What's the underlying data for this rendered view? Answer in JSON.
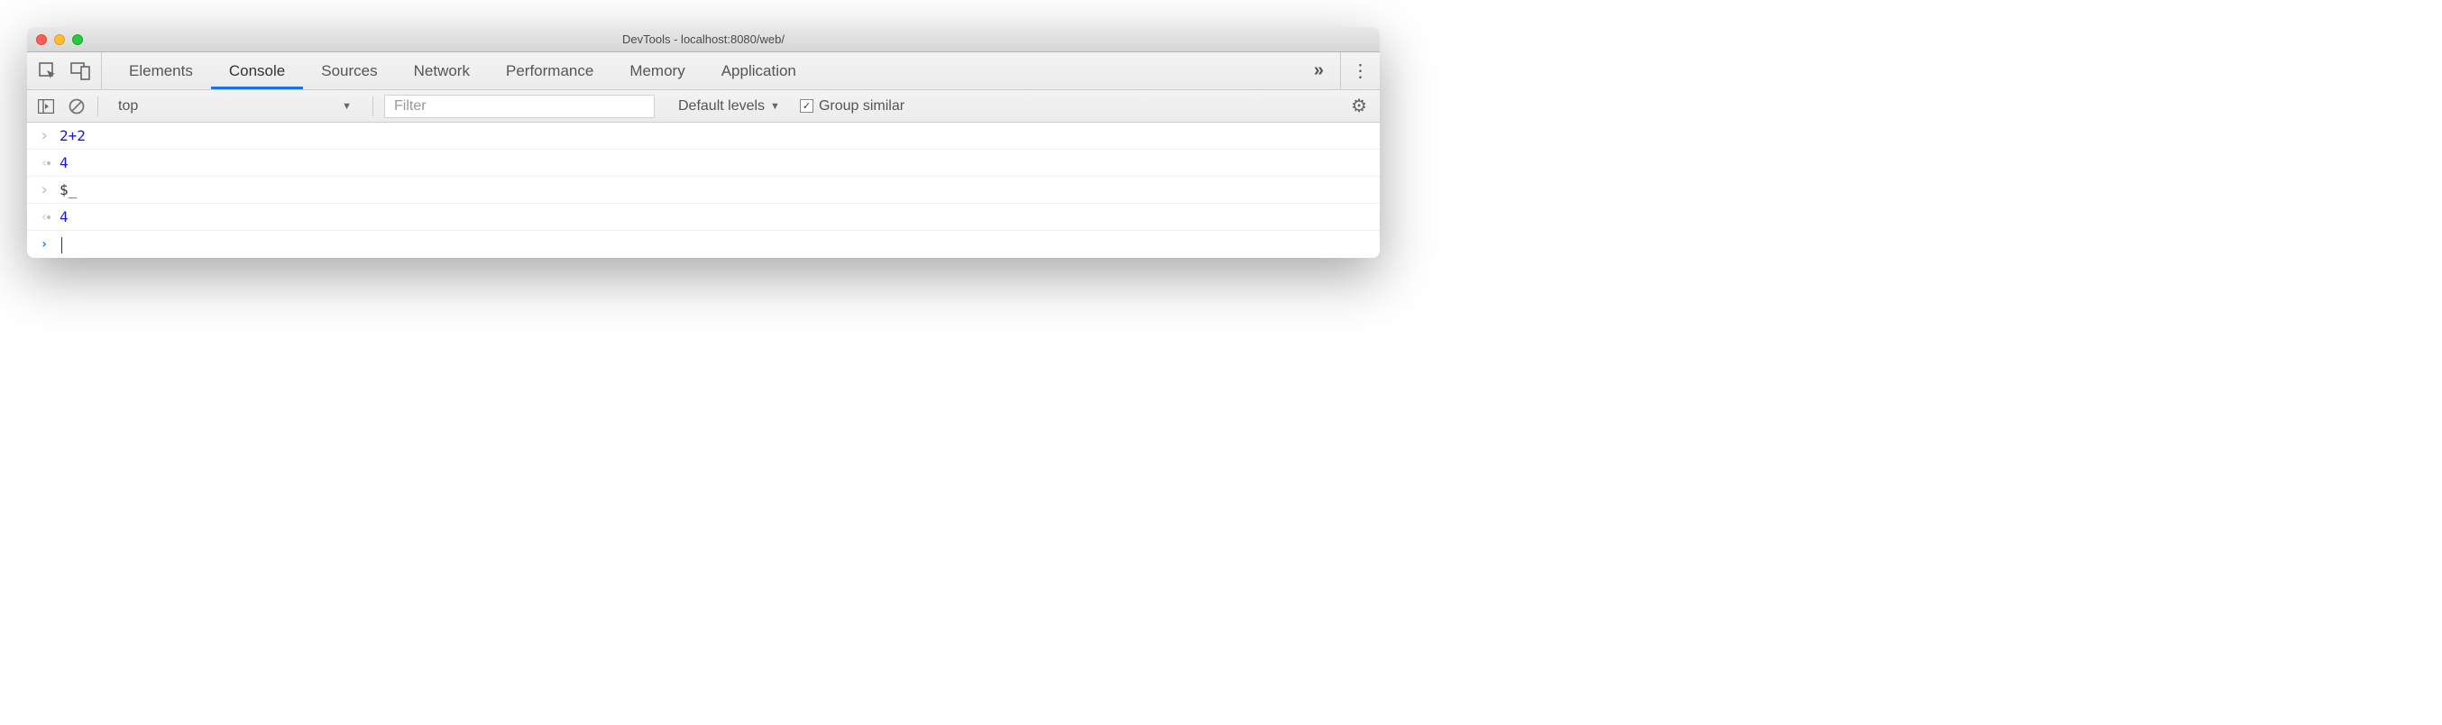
{
  "window": {
    "title": "DevTools - localhost:8080/web/"
  },
  "tabs": {
    "items": [
      "Elements",
      "Console",
      "Sources",
      "Network",
      "Performance",
      "Memory",
      "Application"
    ],
    "active_index": 1,
    "overflow_glyph": "»"
  },
  "toolbar": {
    "context": "top",
    "filter_placeholder": "Filter",
    "levels_label": "Default levels",
    "group_similar_label": "Group similar",
    "group_similar_checked": true
  },
  "console_rows": [
    {
      "kind": "input",
      "tokens": [
        {
          "t": "2",
          "c": "num"
        },
        {
          "t": "+",
          "c": "op"
        },
        {
          "t": "2",
          "c": "num"
        }
      ]
    },
    {
      "kind": "output",
      "tokens": [
        {
          "t": "4",
          "c": "num"
        }
      ]
    },
    {
      "kind": "input",
      "tokens": [
        {
          "t": "$_",
          "c": "ident"
        }
      ]
    },
    {
      "kind": "output",
      "tokens": [
        {
          "t": "4",
          "c": "num"
        }
      ]
    },
    {
      "kind": "prompt",
      "tokens": []
    }
  ]
}
